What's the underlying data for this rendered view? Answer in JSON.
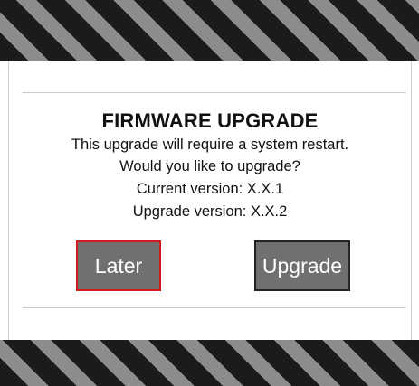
{
  "dialog": {
    "title": "FIRMWARE UPGRADE",
    "lines": [
      "This upgrade will require a system restart.",
      "Would you like to upgrade?",
      "Current version: X.X.1",
      "Upgrade version: X.X.2"
    ],
    "buttons": {
      "later_label": "Later",
      "upgrade_label": "Upgrade"
    }
  },
  "colors": {
    "stripe_dark": "#1b1b1b",
    "stripe_light": "#8c8c8c",
    "button_bg": "#707070",
    "focus_border": "#d11a1a"
  }
}
